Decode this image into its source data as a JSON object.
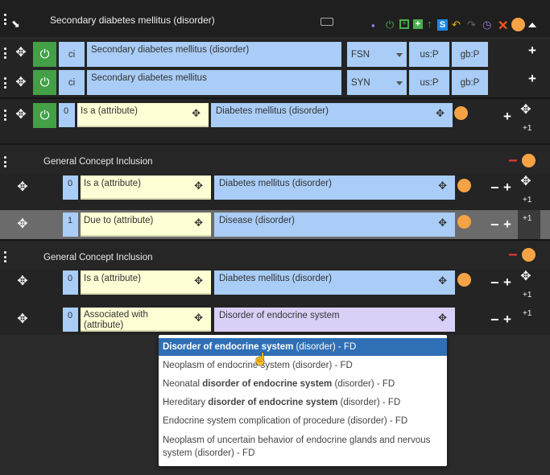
{
  "header": {
    "title": "Secondary diabetes mellitus (disorder)"
  },
  "descriptions": [
    {
      "case": "ci",
      "term": "Secondary diabetes mellitus (disorder)",
      "type": "FSN",
      "lang_us": "us:P",
      "lang_gb": "gb:P"
    },
    {
      "case": "ci",
      "term": "Secondary diabetes mellitus",
      "type": "SYN",
      "lang_us": "us:P",
      "lang_gb": "gb:P"
    }
  ],
  "relationship": {
    "group": "0",
    "attribute": "Is a (attribute)",
    "value": "Diabetes mellitus (disorder)",
    "plus_one": "+1"
  },
  "gci1": {
    "label": "General Concept Inclusion",
    "rows": [
      {
        "group": "0",
        "attribute": "Is a (attribute)",
        "value": "Diabetes mellitus (disorder)",
        "plus_one": "+1"
      },
      {
        "group": "1",
        "attribute": "Due to (attribute)",
        "value": "Disease (disorder)",
        "plus_one": "+1"
      }
    ]
  },
  "gci2": {
    "label": "General Concept Inclusion",
    "rows": [
      {
        "group": "0",
        "attribute": "Is a (attribute)",
        "value": "Diabetes mellitus (disorder)",
        "plus_one": "+1"
      },
      {
        "group": "0",
        "attribute": "Associated with (attribute)",
        "value": "Disorder of endocrine system",
        "plus_one": "+1"
      }
    ]
  },
  "dropdown": {
    "items": [
      {
        "pre": "",
        "bold": "Disorder of endocrine system",
        "post": " (disorder) - FD"
      },
      {
        "pre": "Neoplasm of endocrine system (disorder) - FD",
        "bold": "",
        "post": ""
      },
      {
        "pre": "Neonatal ",
        "bold": "disorder of endocrine system",
        "post": " (disorder) - FD"
      },
      {
        "pre": "Hereditary ",
        "bold": "disorder of endocrine system",
        "post": " (disorder) - FD"
      },
      {
        "pre": "Endocrine system complication of procedure (disorder) - FD",
        "bold": "",
        "post": ""
      },
      {
        "pre": "Neoplasm of uncertain behavior of endocrine glands and nervous system (disorder) - FD",
        "bold": "",
        "post": ""
      }
    ]
  },
  "colors": {
    "accent_green": "#43a047",
    "field_blue": "#a9cdf6",
    "attribute_yellow": "#ffffd5",
    "orange": "#f5a344",
    "highlight": "#2f6fb5"
  }
}
